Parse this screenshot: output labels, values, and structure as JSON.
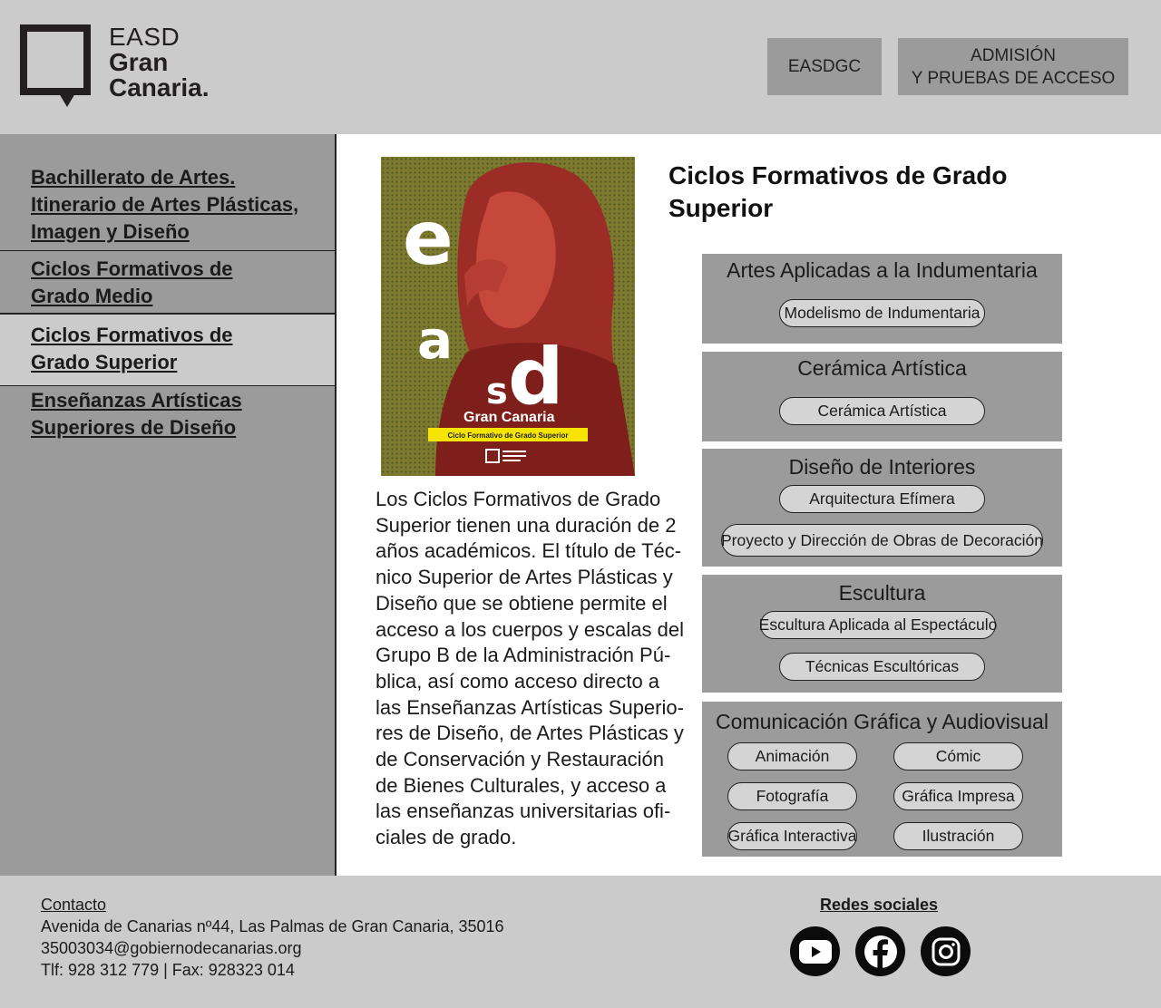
{
  "header": {
    "logo": {
      "line1": "EASD",
      "line2": "Gran",
      "line3": "Canaria."
    },
    "buttons": {
      "easdgc": "EASDGC",
      "admision": "ADMISIÓN\nY PRUEBAS DE ACCESO"
    }
  },
  "sidebar": {
    "items": [
      {
        "label": "Bachillerato de Artes.\nItinerario de Artes Plásticas,\nImagen y Diseño"
      },
      {
        "label": "Ciclos Formativos de\nGrado Medio"
      },
      {
        "label": "Ciclos Formativos de\nGrado Superior"
      },
      {
        "label": "Enseñanzas Artísticas\nSuperiores de Diseño"
      }
    ]
  },
  "main": {
    "title": "Ciclos Formativos de Grado\nSuperior",
    "description": "Los Ciclos Formativos de Grado\nSuperior tienen una duración de 2\naños académicos. El título de Téc-\nnico Superior de Artes Plásticas y\nDiseño que se obtiene permite el\nacceso a los cuerpos y escalas del\nGrupo B de la Administración Pú-\nblica, así como acceso directo a\nlas Enseñanzas Artísticas Superio-\nres de Diseño, de Artes Plásticas y\nde Conservación y Restauración\nde Bienes Culturales, y acceso a\nlas enseñanzas universitarias ofi-\nciales de grado.",
    "poster": {
      "letters": [
        "e",
        "a",
        "s",
        "d"
      ],
      "brand": "Gran Canaria",
      "band": "Ciclo Formativo de Grado Superior",
      "colors": {
        "bg": "#6e6b2c",
        "figure": "#9b2c26",
        "band": "#f5e400"
      }
    },
    "families": [
      {
        "name": "Artes Aplicadas a la Indumentaria",
        "courses": [
          "Modelismo de Indumentaria"
        ]
      },
      {
        "name": "Cerámica Artística",
        "courses": [
          "Cerámica Artística"
        ]
      },
      {
        "name": "Diseño de Interiores",
        "courses": [
          "Arquitectura Efímera",
          "Proyecto y Dirección de Obras de Decoración"
        ]
      },
      {
        "name": "Escultura",
        "courses": [
          "Escultura Aplicada al Espectáculo",
          "Técnicas Escultóricas"
        ]
      },
      {
        "name": "Comunicación Gráfica y Audiovisual",
        "courses": [
          "Animación",
          "Cómic",
          "Fotografía",
          "Gráfica Impresa",
          "Gráfica Interactiva",
          "Ilustración"
        ]
      }
    ]
  },
  "footer": {
    "contact_label": "Contacto",
    "address": "Avenida de Canarias nº44, Las Palmas de Gran Canaria, 35016",
    "email": "35003034@gobiernodecanarias.org",
    "phone": "Tlf: 928 312 779 | Fax: 928323 014",
    "social_label": "Redes sociales",
    "social": [
      {
        "icon": "youtube-icon"
      },
      {
        "icon": "facebook-icon"
      },
      {
        "icon": "instagram-icon"
      }
    ]
  },
  "colors": {
    "header_bg": "#cbcbcb",
    "sidebar_bg": "#9b9b9b",
    "panel_bg": "#9b9b9b",
    "pill_bg": "#d4d4d4",
    "active_item_bg": "#cbcbcb"
  }
}
